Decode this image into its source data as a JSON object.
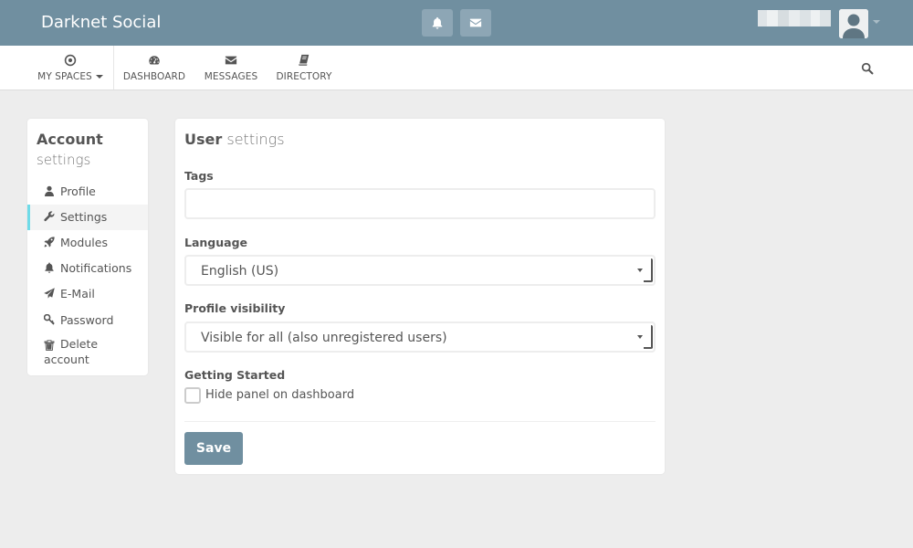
{
  "header": {
    "brand": "Darknet Social",
    "notifications_icon": "bell-icon",
    "messages_icon": "envelope-icon",
    "colors": {
      "topbar": "#708fa0",
      "accent": "#6fdbe8",
      "button": "#708fa0"
    }
  },
  "nav": {
    "items": [
      {
        "label": "MY SPACES",
        "icon": "dot-circle-icon"
      },
      {
        "label": "DASHBOARD",
        "icon": "dashboard-icon"
      },
      {
        "label": "MESSAGES",
        "icon": "envelope-icon"
      },
      {
        "label": "DIRECTORY",
        "icon": "book-icon"
      }
    ],
    "search_icon": "search-icon"
  },
  "sidebar": {
    "title": "Account",
    "subtitle": "settings",
    "items": [
      {
        "label": "Profile",
        "icon": "user-icon"
      },
      {
        "label": "Settings",
        "icon": "wrench-icon"
      },
      {
        "label": "Modules",
        "icon": "rocket-icon"
      },
      {
        "label": "Notifications",
        "icon": "bell-icon"
      },
      {
        "label": "E-Mail",
        "icon": "paper-plane-icon"
      },
      {
        "label": "Password",
        "icon": "key-icon"
      },
      {
        "label": "Delete account",
        "icon": "trash-icon"
      }
    ],
    "active": "Settings"
  },
  "main": {
    "title_bold": "User",
    "title_light": "settings",
    "tags_label": "Tags",
    "tags_value": "",
    "language_label": "Language",
    "language_value": "English (US)",
    "visibility_label": "Profile visibility",
    "visibility_value": "Visible for all (also unregistered users)",
    "getting_started_label": "Getting Started",
    "hide_panel_label": "Hide panel on dashboard",
    "hide_panel_checked": false,
    "save_label": "Save"
  }
}
